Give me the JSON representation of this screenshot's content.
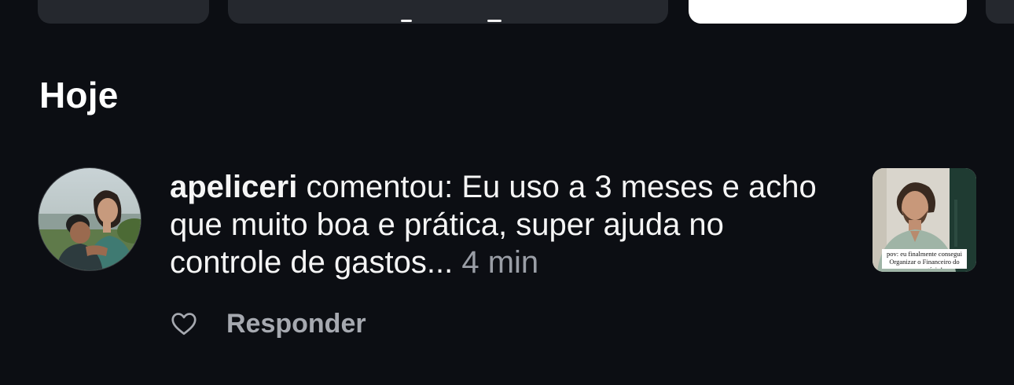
{
  "section": {
    "title": "Hoje"
  },
  "notification": {
    "username": "apeliceri",
    "action_text": " comentou: Eu uso a 3 meses e acho que muito boa e prática, super ajuda no controle de gastos... ",
    "time": "4 min",
    "reply_label": "Responder",
    "post_thumbnail_caption": "pov: eu finalmente consegui Organizar o Financeiro do meu negócio!"
  },
  "icons": {
    "like": "heart-outline-icon"
  },
  "colors": {
    "background": "#0c0e13",
    "chip": "#25282e",
    "chip_active": "#ffffff",
    "secondary_text": "#9a9ea6"
  }
}
